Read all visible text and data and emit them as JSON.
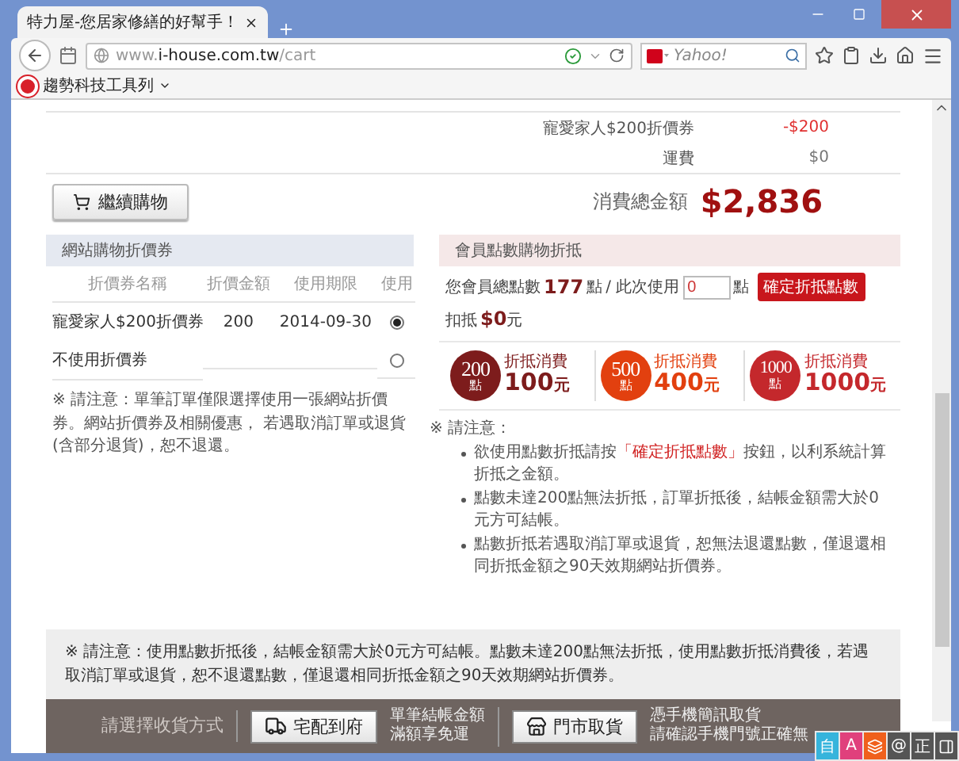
{
  "browser": {
    "tab_title": "特力屋-您居家修繕的好幫手！",
    "url": {
      "prefix": "www.",
      "domain": "i-house.com.tw",
      "path": "/cart"
    },
    "search_placeholder": "Yahoo!",
    "bookmark_toolbar": "趨勢科技工具列"
  },
  "summary": {
    "lines": [
      {
        "label": "寵愛家人$200折價券",
        "amount": "-$200",
        "kind": "discount"
      },
      {
        "label": "運費",
        "amount": "$0",
        "kind": "normal"
      }
    ],
    "continue_button": "繼續購物",
    "total_label": "消費總金額",
    "total": "$2,836"
  },
  "coupons": {
    "title": "網站購物折價券",
    "columns": [
      "折價券名稱",
      "折價金額",
      "使用期限",
      "使用"
    ],
    "rows": [
      {
        "name": "寵愛家人$200折價券",
        "amount": "200",
        "expiry": "2014-09-30",
        "selected": true
      },
      {
        "name": "不使用折價券",
        "selected": false
      }
    ],
    "note": "※ 請注意：單筆訂單僅限選擇使用一張網站折價券。網站折價券及相關優惠， 若遇取消訂單或退貨(含部分退貨)，恕不退還。"
  },
  "points": {
    "title": "會員點數購物折抵",
    "total_label": "您會員總點數",
    "total": "177",
    "unit": "點",
    "use_label": "/ 此次使用",
    "use_value": "0",
    "use_unit": "點",
    "confirm_button": "確定折抵點數",
    "deduct_label": "扣抵",
    "deduct_value": "$0",
    "deduct_unit": "元",
    "tiers": [
      {
        "points": "200",
        "unit": "點",
        "caption": "折抵消費",
        "value": "100",
        "value_unit": "元",
        "color": "#7d1c1c"
      },
      {
        "points": "500",
        "unit": "點",
        "caption": "折抵消費",
        "value": "400",
        "value_unit": "元",
        "color": "#e2400f"
      },
      {
        "points": "1000",
        "unit": "點",
        "caption": "折抵消費",
        "value": "1000",
        "value_unit": "元",
        "color": "#c4282c"
      }
    ],
    "notes_title": "※ 請注意：",
    "notes": [
      {
        "before": "欲使用點數折抵請按",
        "highlight": "「確定折抵點數」",
        "after": "按鈕，以利系統計算折抵之金額。"
      },
      {
        "before": "點數未達200點無法折抵，訂單折抵後，結帳金額需大於0元方可結帳。"
      },
      {
        "before": "點數折抵若遇取消訂單或退貨，恕無法退還點數，僅退還相同折抵金額之90天效期網站折價券。"
      }
    ]
  },
  "footer_note": "※ 請注意：使用點數折抵後，結帳金額需大於0元方可結帳。點數未達200點無法折抵，使用點數折抵消費後，若遇取消訂單或退貨，恕不退還點數，僅退還相同折抵金額之90天效期網站折價券。",
  "delivery": {
    "label": "請選擇收貨方式",
    "options": [
      {
        "kind": "home",
        "button": "宅配到府",
        "info": [
          "單筆結帳金額",
          "滿額享免運"
        ]
      },
      {
        "kind": "store",
        "button": "門市取貨",
        "info": [
          "憑手機簡訊取貨",
          "請確認手機門號正確無"
        ]
      }
    ]
  },
  "ime_bar": [
    {
      "kind": "char",
      "text": "自",
      "color": "#36b4dc"
    },
    {
      "kind": "char",
      "text": "A",
      "color": "#e0407c"
    },
    {
      "kind": "icon",
      "color": "#f0601c"
    },
    {
      "kind": "char",
      "text": "@",
      "color": "#555555"
    },
    {
      "kind": "char",
      "text": "正",
      "color": "#555555"
    },
    {
      "kind": "icon",
      "color": "#555555"
    }
  ]
}
